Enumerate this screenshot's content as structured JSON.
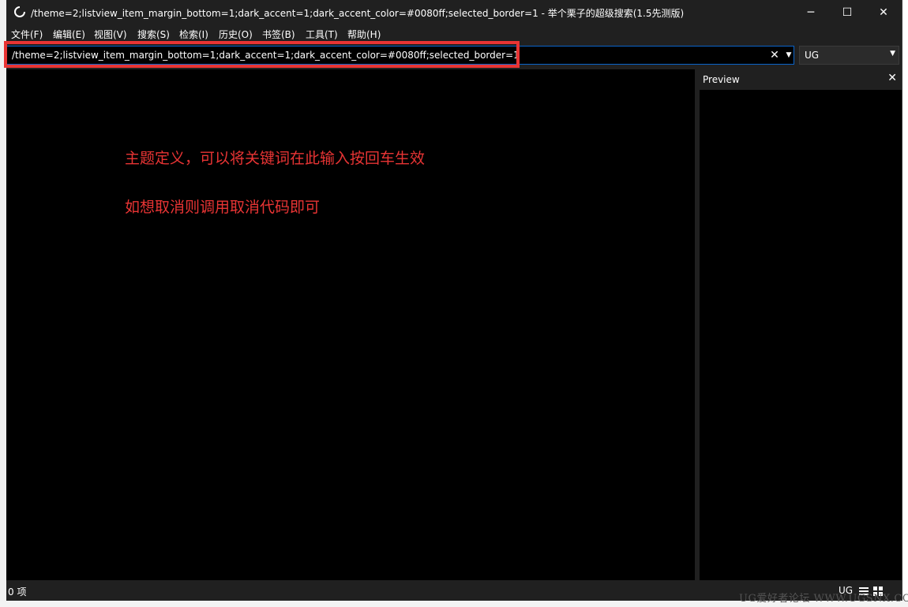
{
  "window": {
    "title": "/theme=2;listview_item_margin_bottom=1;dark_accent=1;dark_accent_color=#0080ff;selected_border=1 - 举个栗子的超级搜索(1.5先测版)",
    "icon": "app-logo-icon",
    "controls": {
      "minimize": "─",
      "maximize": "☐",
      "close": "✕"
    }
  },
  "menu": {
    "items": [
      {
        "label": "文件(F)"
      },
      {
        "label": "编辑(E)"
      },
      {
        "label": "视图(V)"
      },
      {
        "label": "搜索(S)"
      },
      {
        "label": "检索(I)"
      },
      {
        "label": "历史(O)"
      },
      {
        "label": "书签(B)"
      },
      {
        "label": "工具(T)"
      },
      {
        "label": "帮助(H)"
      }
    ]
  },
  "search": {
    "value": "/theme=2;listview_item_margin_bottom=1;dark_accent=1;dark_accent_color=#0080ff;selected_border=1",
    "clear_icon": "✕",
    "dropdown_icon": "▼"
  },
  "filter": {
    "selected": "UG",
    "arrow": "▼"
  },
  "preview": {
    "title": "Preview",
    "close_icon": "✕"
  },
  "annotations": {
    "line1": "主题定义，可以将关键词在此输入按回车生效",
    "line2": "如想取消则调用取消代码即可"
  },
  "status": {
    "count": "0 项",
    "filter": "UG"
  },
  "watermark": "UG爱好者论坛 WWW.UGSNX.COM",
  "colors": {
    "accent": "#0080ff",
    "annotation": "#e83434",
    "background": "#000000",
    "chrome": "#202020"
  }
}
